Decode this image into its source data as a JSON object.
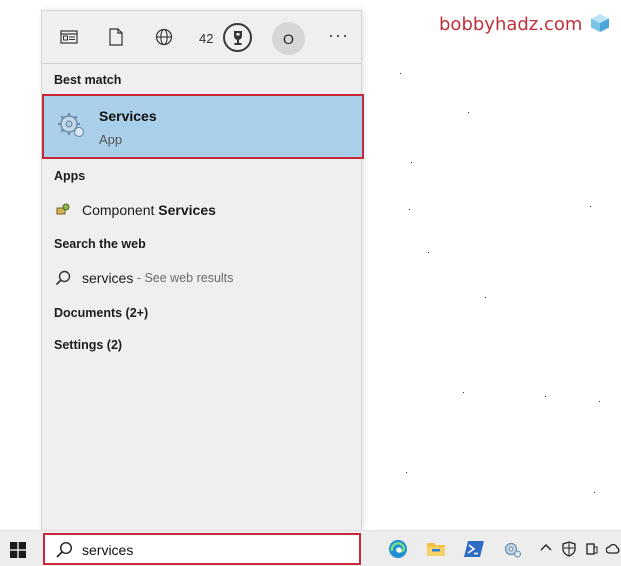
{
  "watermark": "bobbyhadz.com",
  "topbar": {
    "icons": [
      "apps-icon",
      "documents-icon",
      "web-icon"
    ],
    "rewards_count": "42",
    "avatar_letter": "O",
    "more_label": "···"
  },
  "best_match": {
    "heading": "Best match",
    "title": "Services",
    "subtitle": "App"
  },
  "apps": {
    "heading": "Apps",
    "items": [
      {
        "prefix": "Component ",
        "bold": "Services"
      }
    ]
  },
  "web": {
    "heading": "Search the web",
    "query": "services",
    "suffix": " - See web results"
  },
  "documents": {
    "label": "Documents (2+)"
  },
  "settings": {
    "label": "Settings (2)"
  },
  "taskbar": {
    "search_value": "services",
    "apps": [
      "edge-icon",
      "file-explorer-icon",
      "powershell-icon",
      "services-icon"
    ]
  },
  "colors": {
    "highlight": "#aacfe9",
    "border_red": "#c8283a",
    "panel_bg": "#efefef"
  }
}
